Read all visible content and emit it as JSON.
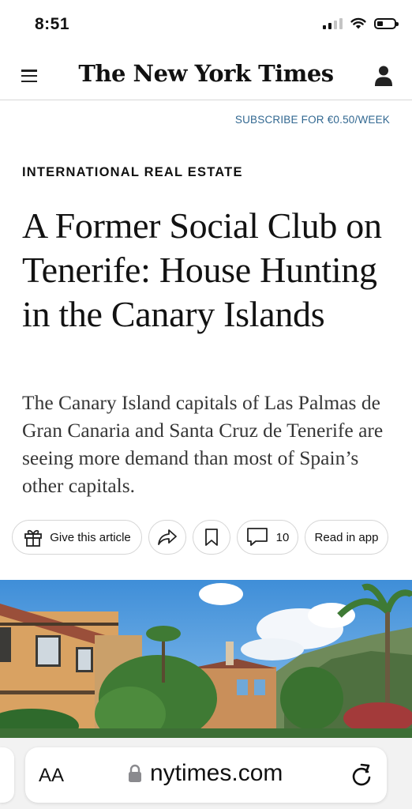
{
  "status_bar": {
    "time": "8:51"
  },
  "masthead": {
    "logo": "The New York Times"
  },
  "subscribe": {
    "label": "SUBSCRIBE FOR €0.50/WEEK"
  },
  "article": {
    "kicker": "INTERNATIONAL REAL ESTATE",
    "headline": "A Former Social Club on Tenerife: House Hunting in the Canary Islands",
    "summary": "The Canary Island capitals of Las Palmas de Gran Canaria and Santa Cruz de Tenerife are seeing more demand than most of Spain’s other capitals."
  },
  "actions": {
    "gift_label": "Give this article",
    "comment_count": "10",
    "read_in_app_label": "Read in app"
  },
  "browser": {
    "text_size_label": "AA",
    "url": "nytimes.com"
  },
  "colors": {
    "subscribe": "#326891",
    "text": "#121212"
  }
}
